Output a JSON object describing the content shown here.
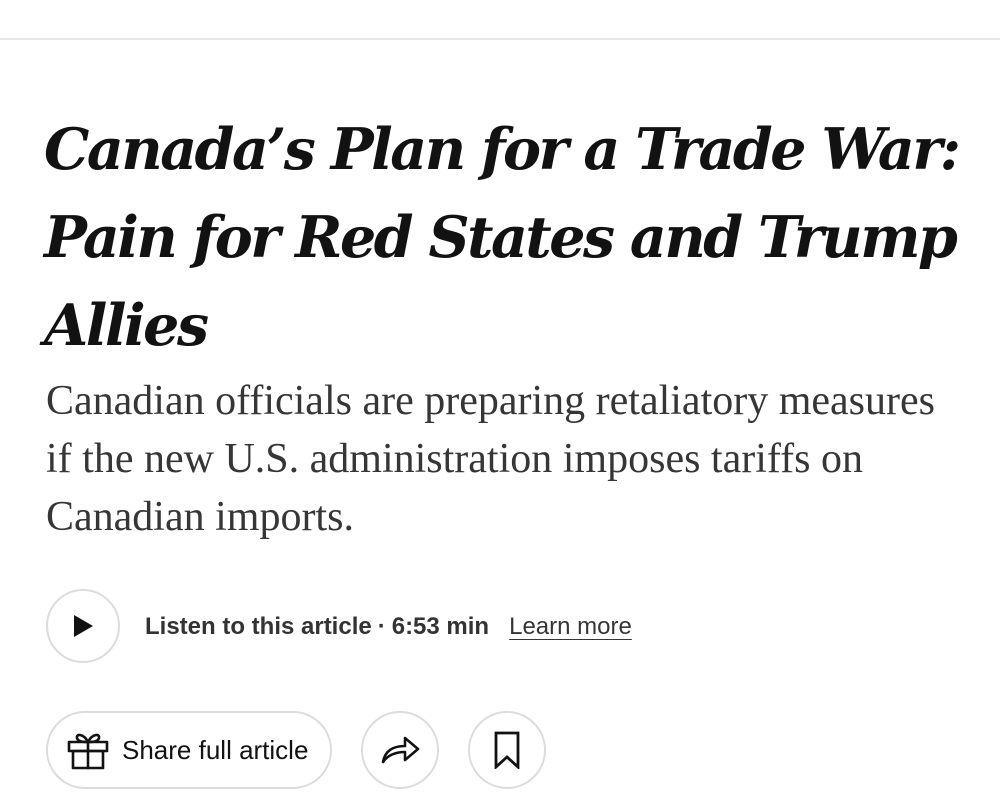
{
  "article": {
    "headline": "Canada’s Plan for a Trade War: Pain for Red States and Trump Allies",
    "summary": "Canadian officials are preparing retaliatory measures if the new U.S. administration imposes tariffs on Canadian imports."
  },
  "audio": {
    "listen_label": "Listen to this article",
    "separator": "·",
    "duration": "6:53 min",
    "learn_more": "Learn more",
    "play_icon": "play-icon"
  },
  "actions": {
    "share_label": "Share full article",
    "share_icon": "gift-icon",
    "forward_icon": "share-arrow-icon",
    "save_icon": "bookmark-icon"
  },
  "colors": {
    "text": "#121212",
    "summary_text": "#363636",
    "border": "#dcdcdc",
    "divider": "#e6e6e6"
  }
}
